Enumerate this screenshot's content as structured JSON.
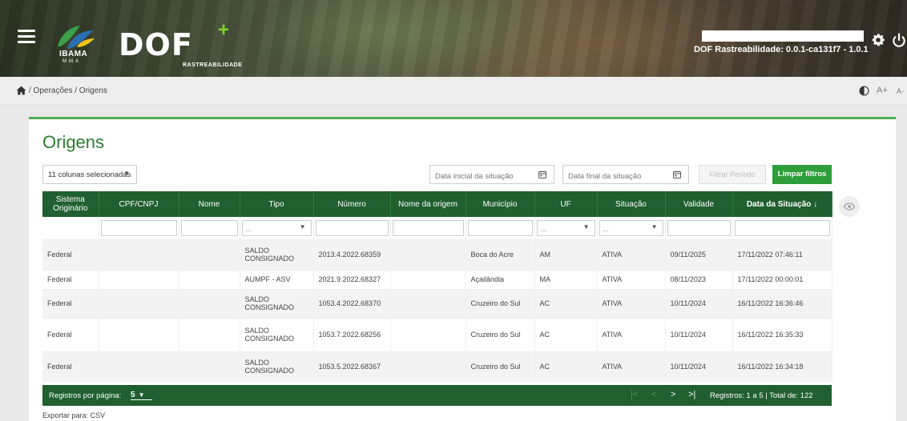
{
  "header": {
    "logo_ibama": "IBAMA",
    "logo_ibama_sub": "MMA",
    "logo_dof": "DOF",
    "logo_dof_plus": "+",
    "logo_dof_sub": "RASTREABILIDADE",
    "version": "DOF Rastreabilidade: 0.0.1-ca131f7 - 1.0.1"
  },
  "breadcrumb": {
    "path": "/ Operações / Origens",
    "font_increase": "A+",
    "font_decrease": "A-"
  },
  "page": {
    "title": "Origens"
  },
  "filters": {
    "columns_selected": "11 colunas selecionadas",
    "date_start_placeholder": "Data inicial da situação",
    "date_end_placeholder": "Data final da situação",
    "filter_period": "Filtrar Período",
    "clear_filters": "Limpar filtros"
  },
  "table": {
    "headers": [
      "Sistema Originário",
      "CPF/CNPJ",
      "Nome",
      "Tipo",
      "Número",
      "Nome da origem",
      "Município",
      "UF",
      "Situação",
      "Validade",
      "Data da Situação"
    ],
    "sort_indicator": "↓",
    "select_placeholder": "...",
    "rows": [
      {
        "sistema": "Federal",
        "cpf": "",
        "nome": "",
        "tipo": "SALDO CONSIGNADO",
        "numero": "2013.4.2022.68359",
        "origem": "",
        "municipio": "Boca do Acre",
        "uf": "AM",
        "situacao": "ATIVA",
        "validade": "09/11/2025",
        "data": "17/11/2022 07:46:11"
      },
      {
        "sistema": "Federal",
        "cpf": "",
        "nome": "",
        "tipo": "AUMPF - ASV",
        "numero": "2021.9.2022.68327",
        "origem": "",
        "municipio": "Açailândia",
        "uf": "MA",
        "situacao": "ATIVA",
        "validade": "08/11/2023",
        "data": "17/11/2022 00:00:01"
      },
      {
        "sistema": "Federal",
        "cpf": "",
        "nome": "",
        "tipo": "SALDO CONSIGNADO",
        "numero": "1053.4.2022.68370",
        "origem": "",
        "municipio": "Cruzeiro do Sul",
        "uf": "AC",
        "situacao": "ATIVA",
        "validade": "10/11/2024",
        "data": "16/11/2022 16:36:46"
      },
      {
        "sistema": "Federal",
        "cpf": "",
        "nome": "",
        "tipo": "SALDO CONSIGNADO",
        "numero": "1053.7.2022.68256",
        "origem": "",
        "municipio": "Cruzeiro do Sul",
        "uf": "AC",
        "situacao": "ATIVA",
        "validade": "10/11/2024",
        "data": "16/11/2022 16:35:33"
      },
      {
        "sistema": "Federal",
        "cpf": "",
        "nome": "",
        "tipo": "SALDO CONSIGNADO",
        "numero": "1053.5.2022.68367",
        "origem": "",
        "municipio": "Cruzeiro do Sul",
        "uf": "AC",
        "situacao": "ATIVA",
        "validade": "10/11/2024",
        "data": "16/11/2022 16:34:18"
      }
    ]
  },
  "pagination": {
    "per_page_label": "Registros por página:",
    "per_page_value": "5",
    "first": "|<",
    "prev": "<",
    "next": ">",
    "last": ">|",
    "info": "Registros: 1 a 5 | Total de: 122"
  },
  "export": {
    "label": "Exportar para:",
    "csv": "CSV"
  },
  "colors": {
    "accent_green": "#2e9e3a",
    "table_header": "#205f2f",
    "title_green": "#2e7d32"
  }
}
